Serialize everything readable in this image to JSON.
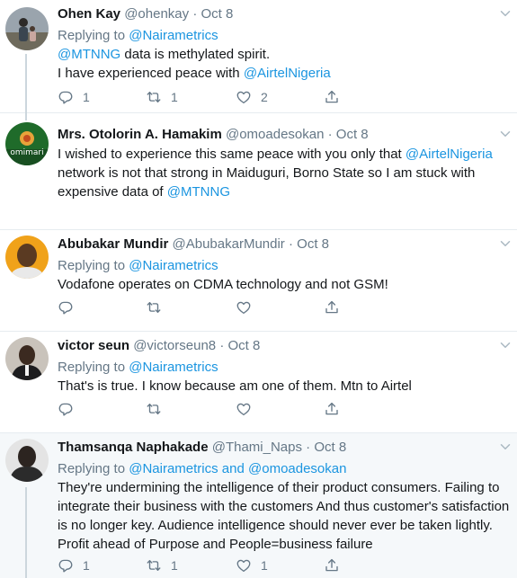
{
  "tweets": [
    {
      "name": "Ohen Kay",
      "handle": "@ohenkay",
      "date": "Oct 8",
      "replying_label": "Replying to",
      "replying_to": "@Nairametrics",
      "line1_mention": "@MTNNG",
      "line1_text": " data is methylated spirit.",
      "line2_text": "I have experienced peace with ",
      "line2_mention": "@AirtelNigeria",
      "reply_count": "1",
      "retweet_count": "1",
      "like_count": "2"
    },
    {
      "name": "Mrs. Otolorin A. Hamakim",
      "handle": "@omoadesokan",
      "date": "Oct 8",
      "line1_text": "I wished to experience this same peace with you only that ",
      "line1_mention": "@AirtelNigeria",
      "line2_text": "network is not that strong in Maiduguri, Borno State so I am stuck with",
      "line3_text": "expensive data of ",
      "line3_mention": "@MTNNG",
      "avatar_text": "omimari"
    },
    {
      "name": "Abubakar Mundir",
      "handle": "@AbubakarMundir",
      "date": "Oct 8",
      "replying_label": "Replying to",
      "replying_to": "@Nairametrics",
      "line1_text": "Vodafone operates on CDMA technology and not GSM!"
    },
    {
      "name": "victor seun",
      "handle": "@victorseun8",
      "date": "Oct 8",
      "replying_label": "Replying to",
      "replying_to": "@Nairametrics",
      "line1_text": "That's is true. I know because am one of them. Mtn to Airtel"
    },
    {
      "name": "Thamsanqa Naphakade",
      "handle": "@Thami_Naps",
      "date": "Oct 8",
      "replying_label": "Replying to",
      "replying_to_1": "@Nairametrics",
      "replying_and": " and ",
      "replying_to_2": "@omoadesokan",
      "line1_text": "They're undermining the intelligence of their product consumers. Failing to",
      "line2_text": "integrate their business with the customers And thus customer's satisfaction",
      "line3_text": "is no longer key. Audience intelligence should never ever be taken lightly.",
      "line4_text": "Profit ahead of Purpose and People=business failure",
      "reply_count": "1",
      "retweet_count": "1",
      "like_count": "1"
    }
  ],
  "separator": "·",
  "icons": {
    "reply": "reply-icon",
    "retweet": "retweet-icon",
    "like": "heart-icon",
    "share": "share-icon",
    "more": "chevron-down-icon"
  },
  "colors": {
    "link": "#1b95e0",
    "muted": "#657786",
    "text": "#14171a",
    "highlight_bg": "#f5f8fa",
    "border": "#e6ecf0"
  }
}
